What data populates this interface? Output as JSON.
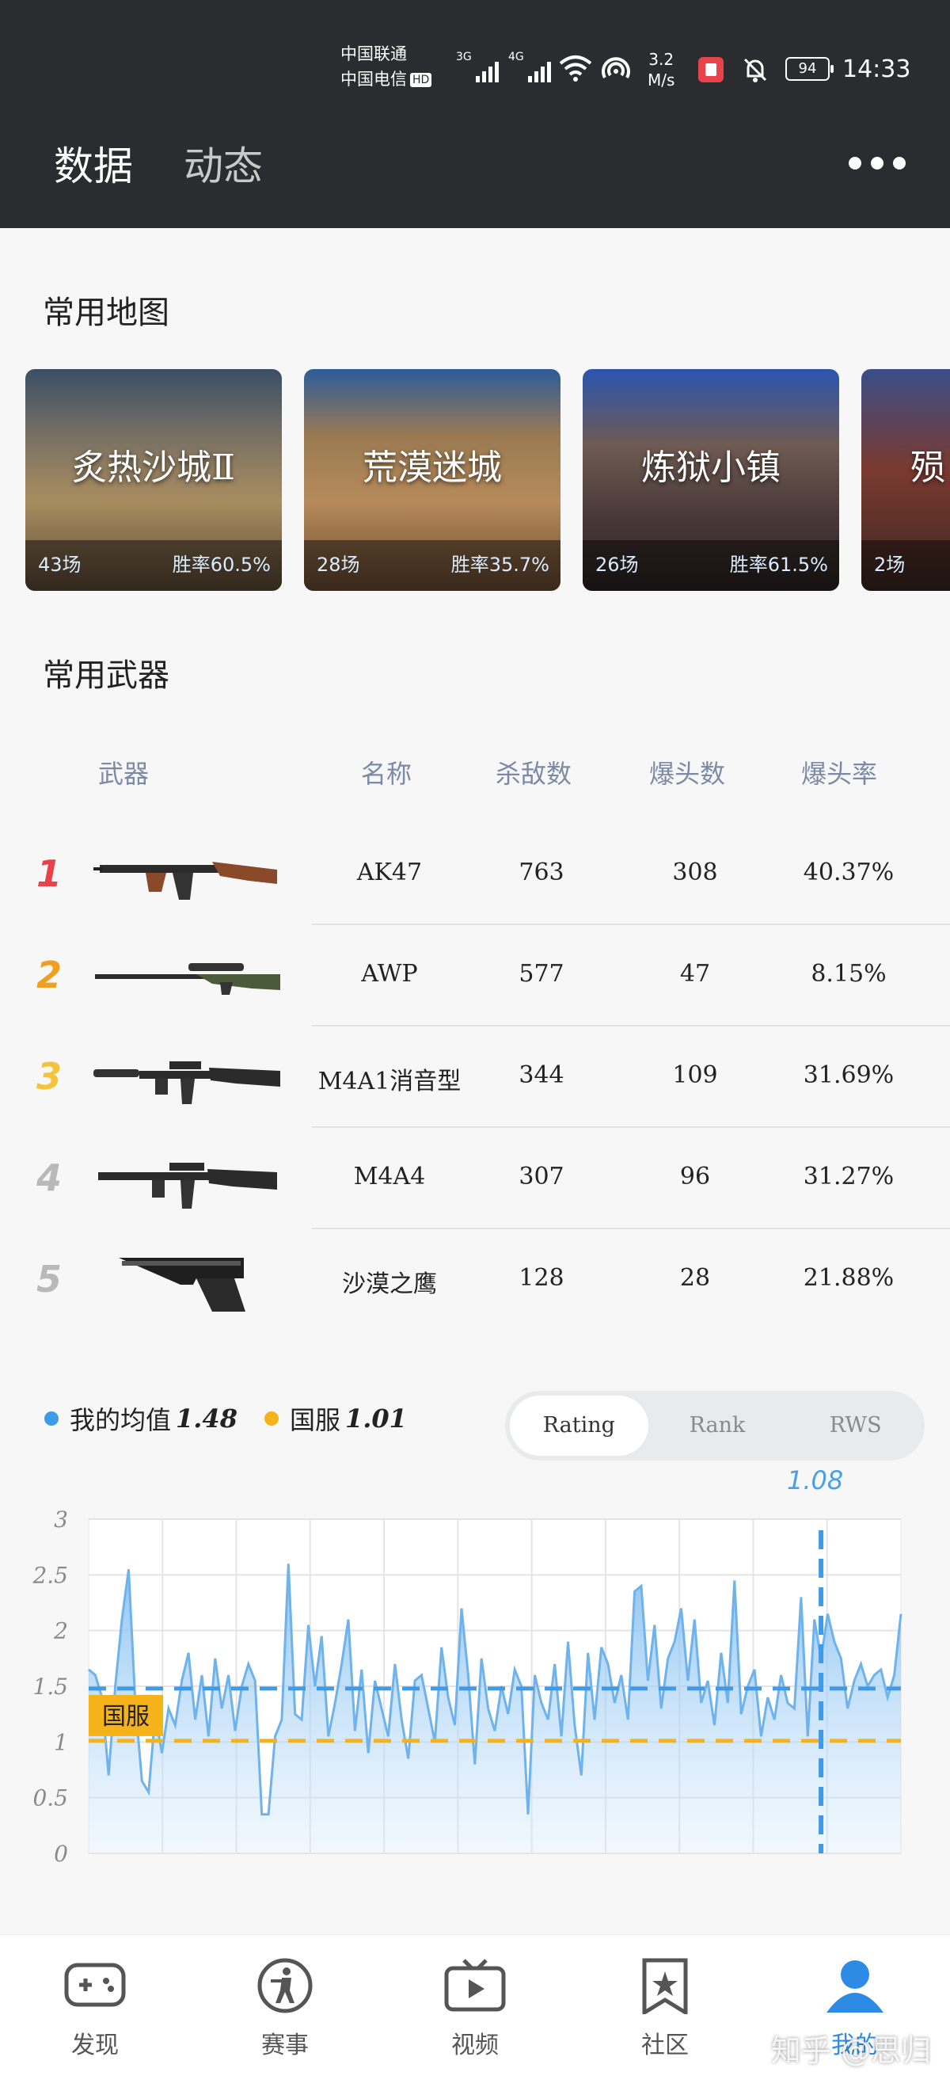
{
  "status": {
    "carrier1": "中国联通",
    "carrier2": "中国电信",
    "hd": "HD",
    "net1": "3G",
    "net2": "4G",
    "speed_value": "3.2",
    "speed_unit": "M/s",
    "battery": "94",
    "time": "14:33"
  },
  "header": {
    "tabs": [
      "数据",
      "动态"
    ],
    "more_icon": "more-dots-icon"
  },
  "maps_section": {
    "title": "常用地图",
    "cards": [
      {
        "name": "炙热沙城Ⅱ",
        "games": "43场",
        "winrate": "胜率60.5%"
      },
      {
        "name": "荒漠迷城",
        "games": "28场",
        "winrate": "胜率35.7%"
      },
      {
        "name": "炼狱小镇",
        "games": "26场",
        "winrate": "胜率61.5%"
      },
      {
        "name": "殒",
        "games": "2场",
        "winrate": ""
      }
    ]
  },
  "weapons_section": {
    "title": "常用武器",
    "columns": [
      "武器",
      "名称",
      "杀敌数",
      "爆头数",
      "爆头率"
    ],
    "rows": [
      {
        "rank": "1",
        "name": "AK47",
        "kills": "763",
        "headshots": "308",
        "hs_rate": "40.37%",
        "icon": "ak47-icon"
      },
      {
        "rank": "2",
        "name": "AWP",
        "kills": "577",
        "headshots": "47",
        "hs_rate": "8.15%",
        "icon": "awp-icon"
      },
      {
        "rank": "3",
        "name": "M4A1消音型",
        "kills": "344",
        "headshots": "109",
        "hs_rate": "31.69%",
        "icon": "m4a1-icon"
      },
      {
        "rank": "4",
        "name": "M4A4",
        "kills": "307",
        "headshots": "96",
        "hs_rate": "31.27%",
        "icon": "m4a4-icon"
      },
      {
        "rank": "5",
        "name": "沙漠之鹰",
        "kills": "128",
        "headshots": "28",
        "hs_rate": "21.88%",
        "icon": "deagle-icon"
      }
    ]
  },
  "rating": {
    "legend_mine": "我的均值",
    "mine_value": "1.48",
    "legend_server": "国服",
    "server_value": "1.01",
    "tabs": [
      "Rating",
      "Rank",
      "RWS"
    ],
    "selected_value": "1.08",
    "avg_tag": "国服"
  },
  "colors": {
    "mine": "#3f9ae8",
    "server": "#f5b21b",
    "rank1": "#e8434b",
    "rank2": "#f0a020",
    "rank3": "#f5c33b",
    "rank_other": "#b9b9b9",
    "nav_active": "#2d8be6"
  },
  "chart_data": {
    "type": "area",
    "ylim": [
      0,
      3
    ],
    "yticks": [
      "0",
      "0.5",
      "1",
      "1.5",
      "2",
      "2.5",
      "3"
    ],
    "grid": true,
    "series": [
      {
        "name": "我的均值",
        "values": [
          1.65,
          1.6,
          1.4,
          0.7,
          1.5,
          2.1,
          2.55,
          1.35,
          0.65,
          0.55,
          1.25,
          0.9,
          1.3,
          1.15,
          1.55,
          1.8,
          1.2,
          1.6,
          1.05,
          1.75,
          1.3,
          1.6,
          1.1,
          1.5,
          1.7,
          1.55,
          0.35,
          0.35,
          1.05,
          1.2,
          2.6,
          1.25,
          1.2,
          2.05,
          1.5,
          1.95,
          1.05,
          1.35,
          1.7,
          2.1,
          1.1,
          1.65,
          0.9,
          1.55,
          1.3,
          1.05,
          1.7,
          1.2,
          0.85,
          1.55,
          1.6,
          1.3,
          1.0,
          1.85,
          1.4,
          1.15,
          2.2,
          1.6,
          0.8,
          1.75,
          1.3,
          1.1,
          1.5,
          1.25,
          1.65,
          1.5,
          0.35,
          1.6,
          1.35,
          1.2,
          1.7,
          1.05,
          1.9,
          1.15,
          0.7,
          1.8,
          1.2,
          1.85,
          1.7,
          1.35,
          1.6,
          1.2,
          2.35,
          2.4,
          1.55,
          2.05,
          1.3,
          1.75,
          1.9,
          2.2,
          1.55,
          2.1,
          1.35,
          1.55,
          1.15,
          1.8,
          1.35,
          2.45,
          1.25,
          1.5,
          1.65,
          1.05,
          1.4,
          1.2,
          1.6,
          1.35,
          1.3,
          2.3,
          1.05,
          2.1,
          1.75,
          2.15,
          1.9,
          1.75,
          1.3,
          1.55,
          1.7,
          1.5,
          1.6,
          1.65,
          1.4,
          1.6,
          2.15
        ]
      },
      {
        "name": "我的均值",
        "values": [
          1.48
        ]
      },
      {
        "name": "国服",
        "values": [
          1.01
        ]
      }
    ],
    "selected_index": 110,
    "selected_value": 1.08
  },
  "nav": {
    "items": [
      {
        "label": "发现",
        "icon": "gamepad-icon"
      },
      {
        "label": "赛事",
        "icon": "soldier-icon"
      },
      {
        "label": "视频",
        "icon": "tv-play-icon"
      },
      {
        "label": "社区",
        "icon": "star-bookmark-icon"
      },
      {
        "label": "我的",
        "icon": "user-icon"
      }
    ],
    "active": 4
  },
  "watermark": "知乎 @思归"
}
